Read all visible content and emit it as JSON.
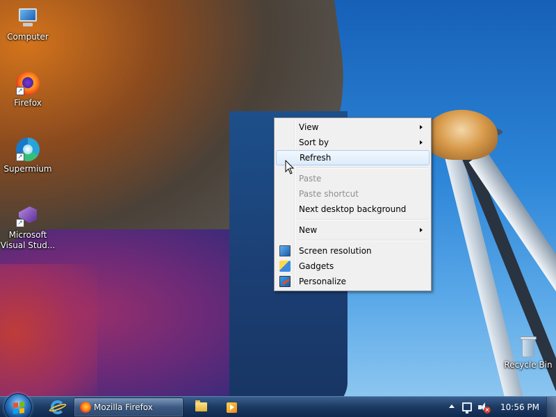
{
  "desktop": {
    "icons": [
      {
        "label": "Computer",
        "icon": "computer-icon"
      },
      {
        "label": "Firefox",
        "icon": "firefox-icon"
      },
      {
        "label": "Supermium",
        "icon": "supermium-icon"
      },
      {
        "label": "Microsoft Visual Stud...",
        "icon": "visual-studio-icon"
      },
      {
        "label": "Recycle Bin",
        "icon": "recycle-bin-icon"
      }
    ]
  },
  "context_menu": {
    "items": [
      {
        "label": "View",
        "submenu": true,
        "enabled": true
      },
      {
        "label": "Sort by",
        "submenu": true,
        "enabled": true
      },
      {
        "label": "Refresh",
        "submenu": false,
        "enabled": true,
        "highlighted": true
      },
      {
        "label": "Paste",
        "submenu": false,
        "enabled": false
      },
      {
        "label": "Paste shortcut",
        "submenu": false,
        "enabled": false
      },
      {
        "label": "Next desktop background",
        "submenu": false,
        "enabled": true
      },
      {
        "label": "New",
        "submenu": true,
        "enabled": true
      },
      {
        "label": "Screen resolution",
        "submenu": false,
        "enabled": true,
        "icon": "screen-resolution-icon"
      },
      {
        "label": "Gadgets",
        "submenu": false,
        "enabled": true,
        "icon": "gadgets-icon"
      },
      {
        "label": "Personalize",
        "submenu": false,
        "enabled": true,
        "icon": "personalize-icon"
      }
    ]
  },
  "taskbar": {
    "pinned": [
      "internet-explorer-icon",
      "windows-explorer-icon",
      "media-player-icon"
    ],
    "active_window": {
      "label": "Mozilla Firefox",
      "icon": "firefox-icon"
    },
    "tray": {
      "clock": "10:56 PM",
      "icons": [
        "show-hidden-icons-chevron",
        "network-icon",
        "volume-muted-icon"
      ]
    }
  },
  "colors": {
    "menu_background": "#f0f0f0",
    "menu_highlight_border": "#a8d0f3",
    "disabled_text": "#8e8e8e",
    "taskbar": "#1c385f"
  }
}
